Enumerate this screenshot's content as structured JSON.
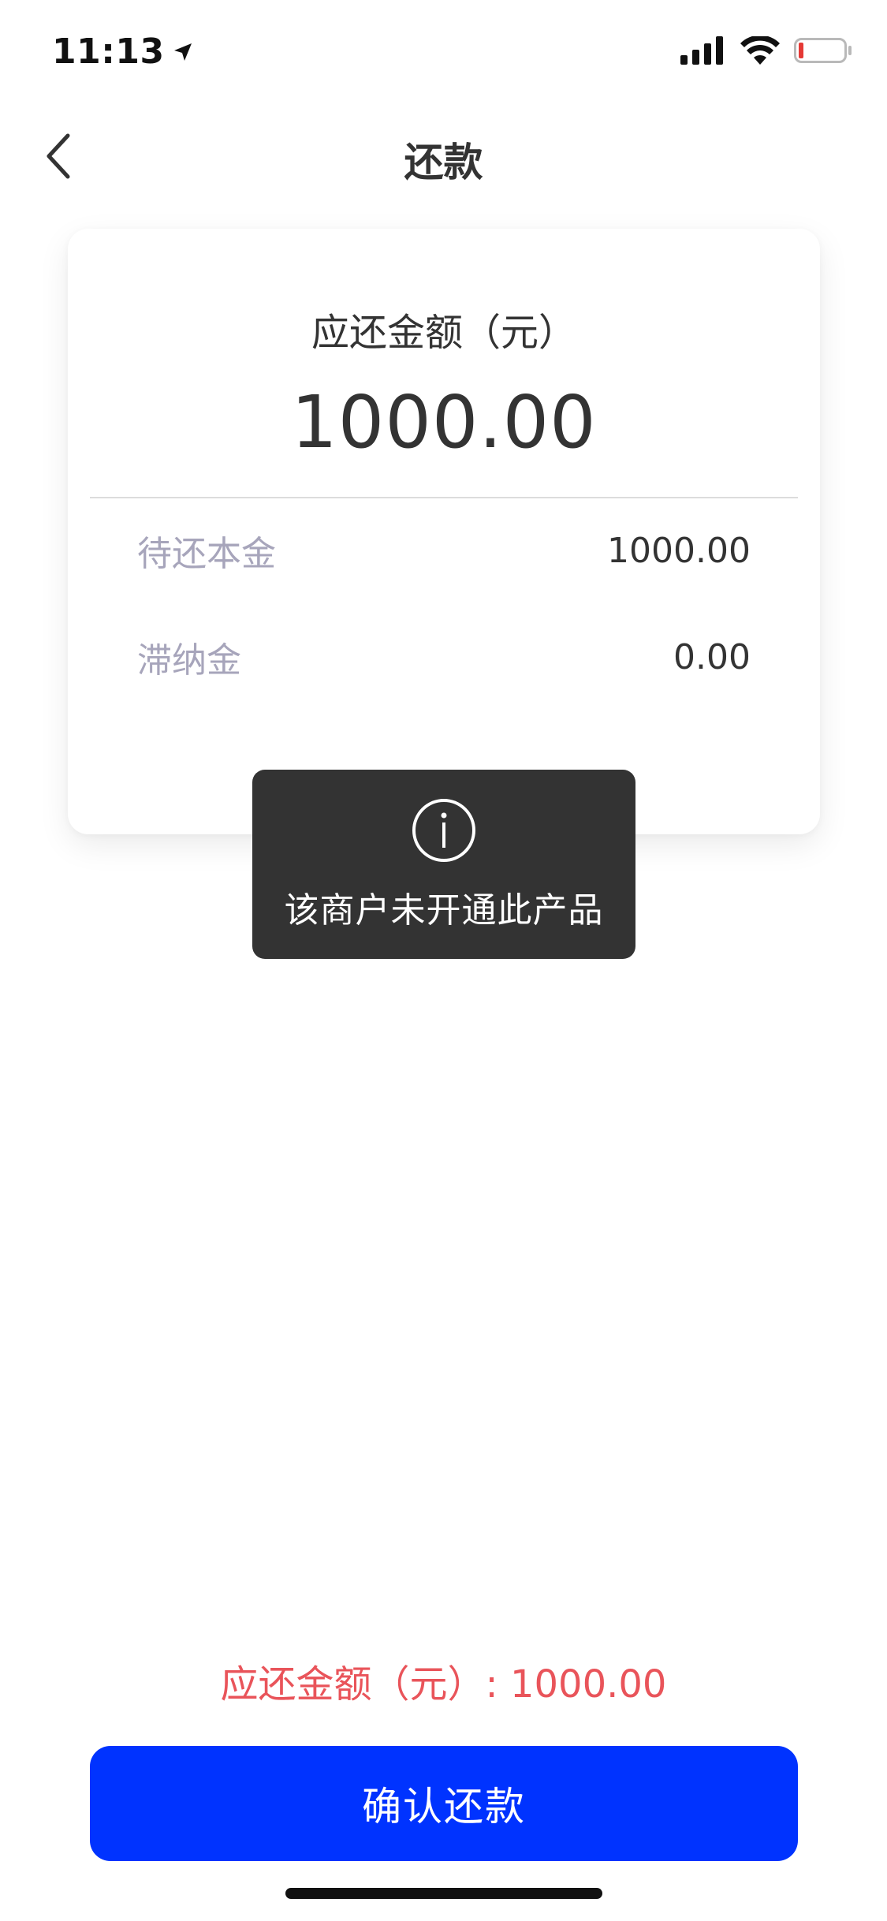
{
  "status_bar": {
    "time": "11:13"
  },
  "nav": {
    "title": "还款"
  },
  "card": {
    "label": "应还金额（元）",
    "amount": "1000.00",
    "rows": [
      {
        "label": "待还本金",
        "value": "1000.00"
      },
      {
        "label": "滞纳金",
        "value": "0.00"
      }
    ]
  },
  "toast": {
    "message": "该商户未开通此产品"
  },
  "footer": {
    "summary": "应还金额（元）: 1000.00",
    "confirm_label": "确认还款"
  },
  "colors": {
    "accent": "#0033ff",
    "summary_text": "#e9545a",
    "toast_bg": "#333333",
    "muted_label": "#a7a5bb"
  }
}
